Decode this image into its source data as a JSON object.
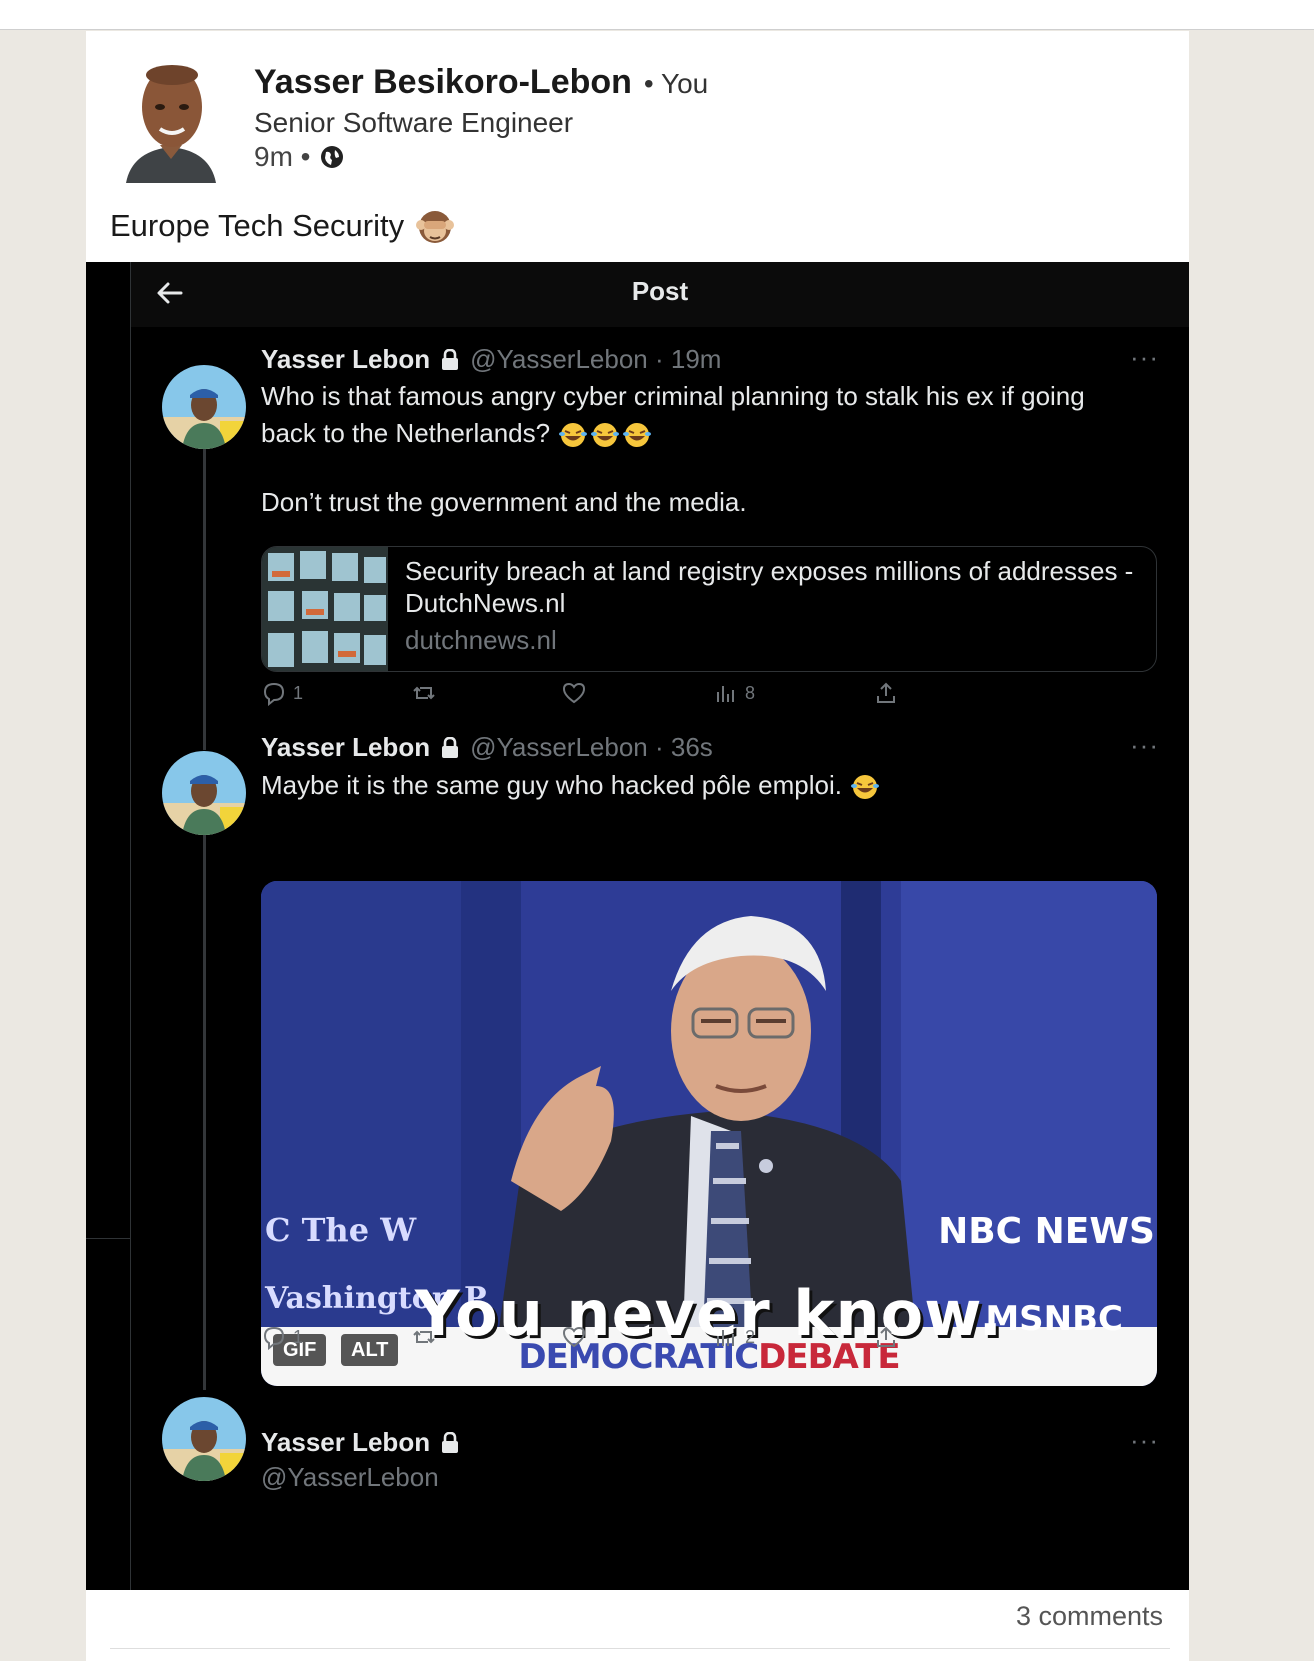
{
  "linkedin_post": {
    "author_name": "Yasser Besikoro-Lebon",
    "connection": "• You",
    "headline": "Senior Software Engineer",
    "time": "9m •",
    "visibility_icon": "globe-icon",
    "text": "Europe Tech Security",
    "text_emoji": "see-no-evil-monkey"
  },
  "screenshot": {
    "title": "Post",
    "tweets": [
      {
        "name": "Yasser Lebon",
        "handle_time": "@YasserLebon · 19m",
        "text_line1": "Who is that famous angry cyber criminal planning to stalk his ex if going",
        "text_line2": "back to the Netherlands?",
        "text_para2": "Don’t trust the government and the media.",
        "link_card": {
          "title": "Security breach at land registry exposes millions of addresses - DutchNews.nl",
          "domain": "dutchnews.nl"
        },
        "replies": "1",
        "views": "8"
      },
      {
        "name": "Yasser Lebon",
        "handle_time": "@YasserLebon · 36s",
        "text": "Maybe it is the same guy who hacked pôle emploi.",
        "gif": {
          "caption": "You never know.",
          "brand_left_top": "C     The W",
          "brand_left_bottom": "Vashington P",
          "nbc": "NBC NEWS",
          "msnbc": "MSNBC",
          "banner_part1": "DEMOCRATIC",
          "banner_part2": "DEBATE",
          "badge_gif": "GIF",
          "badge_alt": "ALT"
        },
        "replies": "1",
        "views": "2"
      },
      {
        "name": "Yasser Lebon",
        "handle": "@YasserLebon"
      }
    ],
    "more_label": "···"
  },
  "footer": {
    "comments": "3 comments"
  },
  "colors": {
    "page_bg": "#ebe8e2",
    "card_bg": "#ffffff",
    "x_bg": "#000000",
    "x_muted": "#71767b"
  }
}
